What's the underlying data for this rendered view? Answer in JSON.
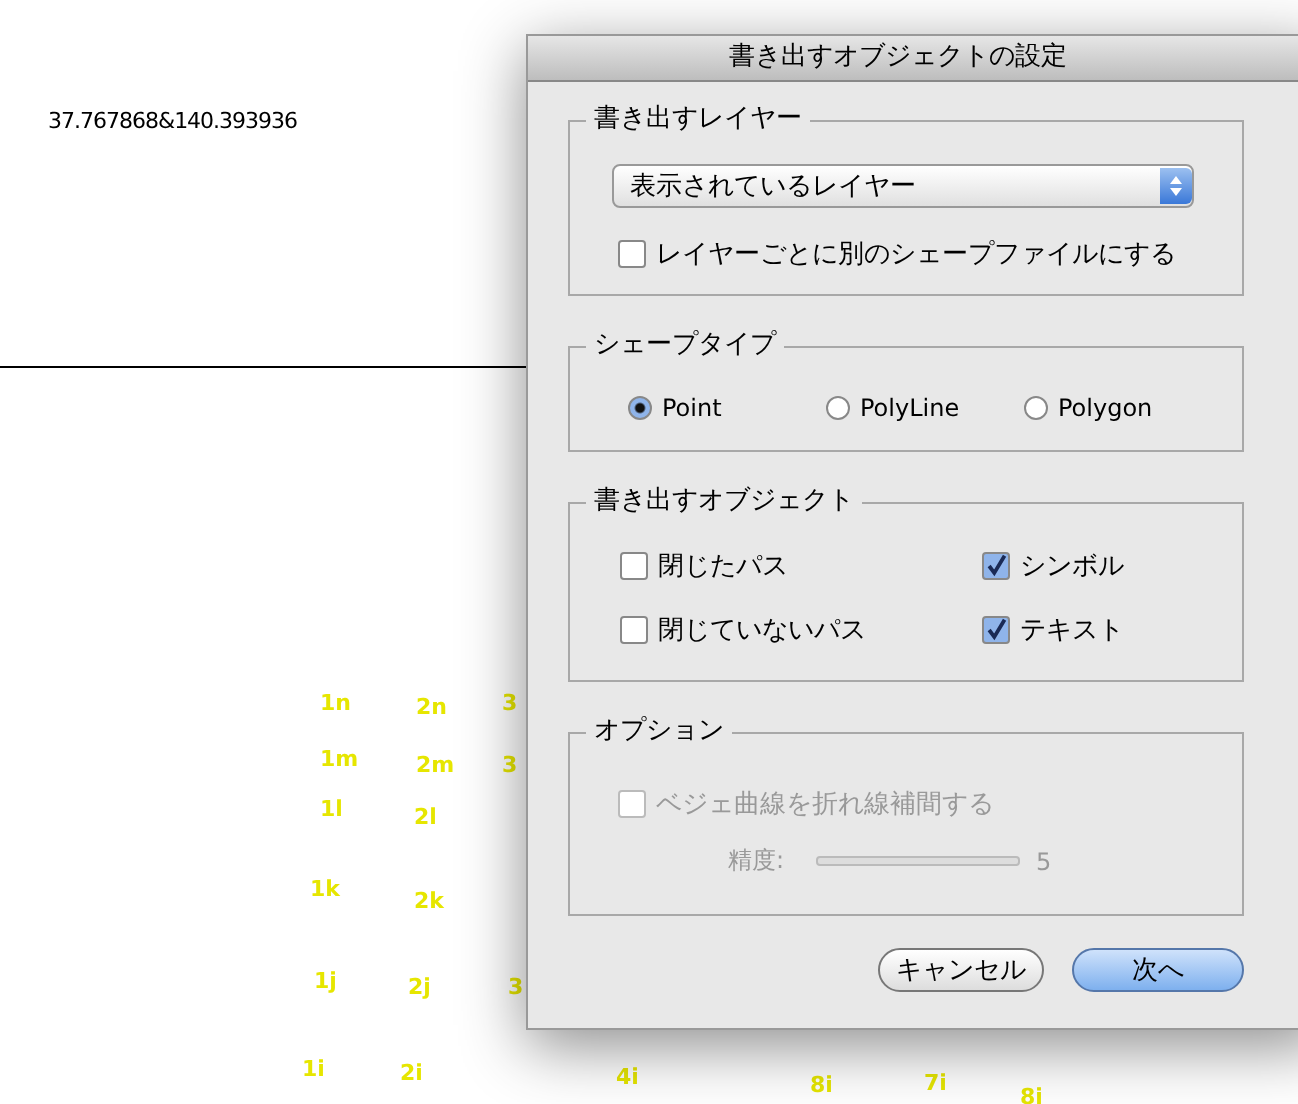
{
  "coordinates": "37.767868&140.393936",
  "map_labels": [
    {
      "text": "1n"
    },
    {
      "text": "2n"
    },
    {
      "text": "3"
    },
    {
      "text": "1m"
    },
    {
      "text": "2m"
    },
    {
      "text": "3"
    },
    {
      "text": "1l"
    },
    {
      "text": "2l"
    },
    {
      "text": "1k"
    },
    {
      "text": "2k"
    },
    {
      "text": "1j"
    },
    {
      "text": "2j"
    },
    {
      "text": "3"
    },
    {
      "text": "1i"
    },
    {
      "text": "2i"
    },
    {
      "text": "4i"
    },
    {
      "text": "8i"
    },
    {
      "text": "7i"
    },
    {
      "text": "8i"
    }
  ],
  "dialog": {
    "title": "書き出すオブジェクトの設定",
    "export_layer": {
      "legend": "書き出すレイヤー",
      "popup": {
        "value": "表示されているレイヤー"
      },
      "checkbox": {
        "label": "レイヤーごとに別のシェープファイルにする",
        "checked": false
      }
    },
    "shape_type": {
      "legend": "シェープタイプ",
      "options": [
        {
          "label": "Point",
          "selected": true
        },
        {
          "label": "PolyLine",
          "selected": false
        },
        {
          "label": "Polygon",
          "selected": false
        }
      ]
    },
    "export_objects": {
      "legend": "書き出すオブジェクト",
      "checkboxes": [
        {
          "label": "閉じたパス",
          "checked": false
        },
        {
          "label": "シンボル",
          "checked": true
        },
        {
          "label": "閉じていないパス",
          "checked": false
        },
        {
          "label": "テキスト",
          "checked": true
        }
      ]
    },
    "options": {
      "legend": "オプション",
      "checkbox": {
        "label": "ベジェ曲線を折れ線補間する",
        "checked": false,
        "disabled": true
      },
      "precision": {
        "label": "精度:",
        "reading": "5",
        "disabled": true
      }
    },
    "buttons": [
      {
        "label": "キャンセル",
        "kind": "cancel"
      },
      {
        "label": "次へ",
        "kind": "default"
      }
    ]
  }
}
